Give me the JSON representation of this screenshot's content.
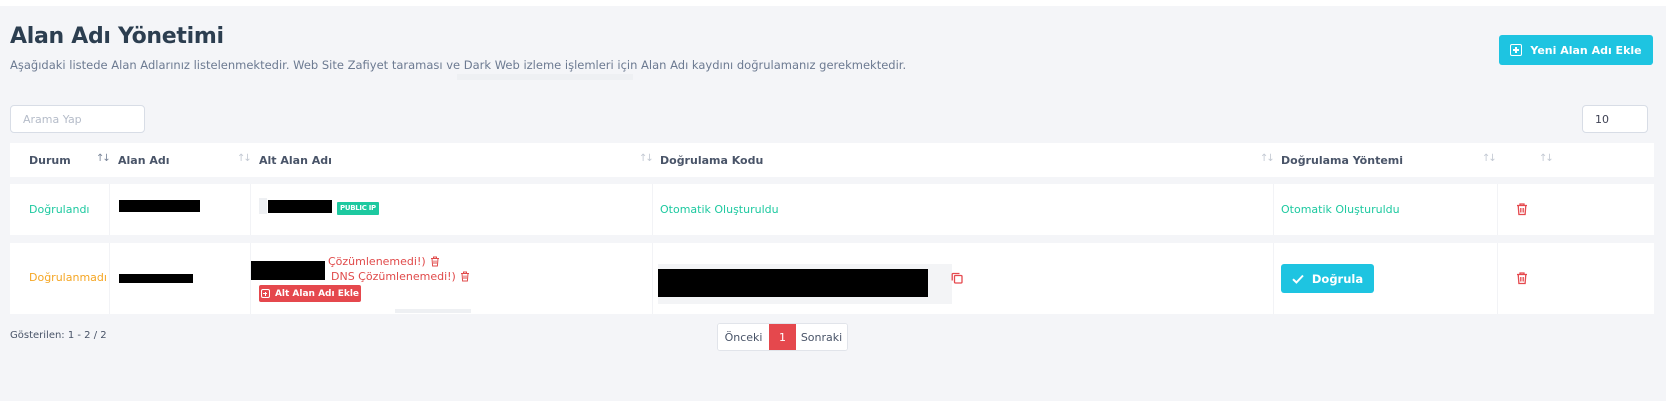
{
  "header": {
    "title": "Alan Adı Yönetimi",
    "subtitle": "Aşağıdaki listede Alan Adlarınız listelenmektedir. Web Site Zafiyet taraması ve Dark Web izleme işlemleri için Alan Adı kaydını doğrulamanız gerekmektedir.",
    "add_button_label": "Yeni Alan Adı Ekle"
  },
  "search": {
    "placeholder": "Arama Yap",
    "value": ""
  },
  "page_size": "10",
  "table": {
    "columns": [
      "Durum",
      "Alan Adı",
      "Alt Alan Adı",
      "Doğrulama Kodu",
      "Doğrulama Yöntemi"
    ],
    "rows": [
      {
        "status": "Doğrulandı",
        "status_color": "#1dc9a0",
        "subdomain_badge": "PUBLIC IP",
        "verification_code": "Otomatik Oluşturuldu",
        "verification_method": "Otomatik Oluşturuldu"
      },
      {
        "status": "Doğrulanmadı",
        "status_color": "#f5a623",
        "subdomain_errors": [
          "Çözümlenemedi!)",
          "DNS Çözümlenemedi!)"
        ],
        "add_subdomain_label": "Alt Alan Adı Ekle",
        "verify_button_label": "Doğrula"
      }
    ]
  },
  "footer": {
    "showing": "Gösterilen: 1 - 2 / 2",
    "prev_label": "Önceki",
    "current_page": "1",
    "next_label": "Sonraki"
  },
  "colors": {
    "accent": "#1ec4e1",
    "success": "#1dc9a0",
    "warning": "#f5a623",
    "danger": "#e5484d"
  },
  "icons": [
    "plus-square-icon",
    "sort-icon",
    "trash-icon",
    "copy-icon",
    "check-icon"
  ]
}
